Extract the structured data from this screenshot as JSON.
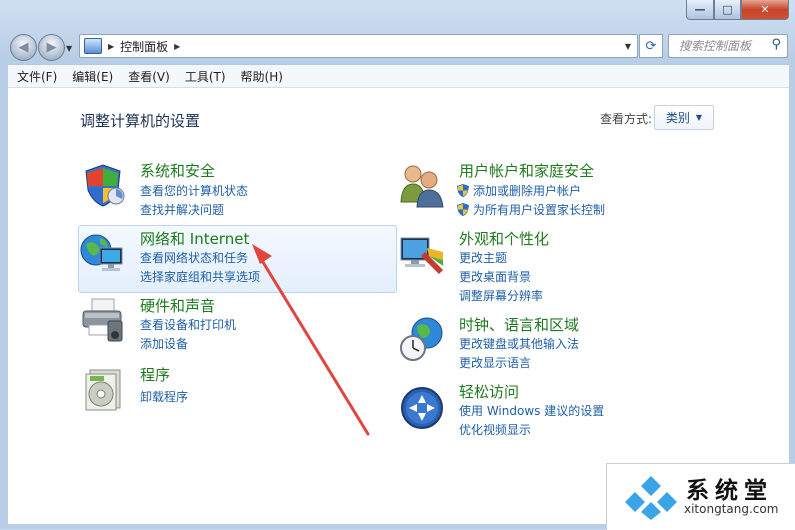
{
  "address": {
    "crumb": "控制面板"
  },
  "search": {
    "placeholder": "搜索控制面板"
  },
  "menu": [
    "文件(F)",
    "编辑(E)",
    "查看(V)",
    "工具(T)",
    "帮助(H)"
  ],
  "content": {
    "title": "调整计算机的设置",
    "view_by_label": "查看方式:",
    "view_by_value": "类别"
  },
  "categories": [
    {
      "title": "系统和安全",
      "links": [
        "查看您的计算机状态",
        "查找并解决问题"
      ]
    },
    {
      "title": "网络和 Internet",
      "links": [
        "查看网络状态和任务",
        "选择家庭组和共享选项"
      ]
    },
    {
      "title": "硬件和声音",
      "links": [
        "查看设备和打印机",
        "添加设备"
      ]
    },
    {
      "title": "程序",
      "links": [
        "卸载程序"
      ]
    },
    {
      "title": "用户帐户和家庭安全",
      "links": [
        "添加或删除用户帐户",
        "为所有用户设置家长控制"
      ]
    },
    {
      "title": "外观和个性化",
      "links": [
        "更改主题",
        "更改桌面背景",
        "调整屏幕分辨率"
      ]
    },
    {
      "title": "时钟、语言和区域",
      "links": [
        "更改键盘或其他输入法",
        "更改显示语言"
      ]
    },
    {
      "title": "轻松访问",
      "links": [
        "使用 Windows 建议的设置",
        "优化视频显示"
      ]
    }
  ],
  "watermark": {
    "name": "系统堂",
    "url": "xitongtang.com"
  },
  "colors": {
    "category_title": "#1f7a1f",
    "link": "#1f5fa8",
    "arrow": "#e0463f"
  },
  "icons": [
    "back-arrow-icon",
    "forward-arrow-icon",
    "control-panel-icon",
    "refresh-icon",
    "search-icon"
  ]
}
